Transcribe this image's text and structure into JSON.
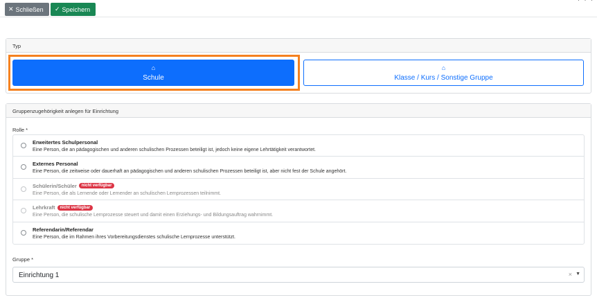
{
  "toolbar": {
    "close_label": "Schließen",
    "save_label": "Speichern",
    "close_icon": "close-icon",
    "save_icon": "check-icon",
    "top_icons": "· · ·"
  },
  "typ": {
    "header": "Typ",
    "options": [
      {
        "label": "Schule",
        "icon": "home-icon",
        "selected": true
      },
      {
        "label": "Klasse / Kurs / Sonstige Gruppe",
        "icon": "graduation-cap-icon",
        "selected": false
      }
    ]
  },
  "membership": {
    "header": "Gruppenzugehörigkeit anlegen für Einrichtung",
    "role_label": "Rolle *",
    "roles": [
      {
        "title": "Erweitertes Schulpersonal",
        "description": "Eine Person, die an pädagogischen und anderen schulischen Prozessen beteiligt ist, jedoch keine eigene Lehrtätigkeit verantwortet.",
        "badge": "",
        "disabled": false
      },
      {
        "title": "Externes Personal",
        "description": "Eine Person, die zeitweise oder dauerhaft an pädagogischen und anderen schulischen Prozessen beteiligt ist, aber nicht fest der Schule angehört.",
        "badge": "",
        "disabled": false
      },
      {
        "title": "Schülerin/Schüler",
        "description": "Eine Person, die als Lernende oder Lernender an schulischen Lernprozessen teilnimmt.",
        "badge": "nicht verfügbar",
        "disabled": true
      },
      {
        "title": "Lehrkraft",
        "description": "Eine Person, die schulische Lernprozesse steuert und damit einen Erziehungs- und Bildungsauftrag wahrnimmt.",
        "badge": "nicht verfügbar",
        "disabled": true
      },
      {
        "title": "Referendarin/Referendar",
        "description": "Eine Person, die im Rahmen ihres Vorbereitungsdienstes schulische Lernprozesse unterstützt.",
        "badge": "",
        "disabled": false
      }
    ],
    "group_label": "Gruppe *",
    "group_value": "Einrichtung 1",
    "clear_glyph": "×",
    "caret_glyph": "▼"
  },
  "colors": {
    "primary": "#0d6efd",
    "success": "#198754",
    "secondary": "#6c757d",
    "danger": "#dc3545",
    "focus": "#f5811f"
  }
}
